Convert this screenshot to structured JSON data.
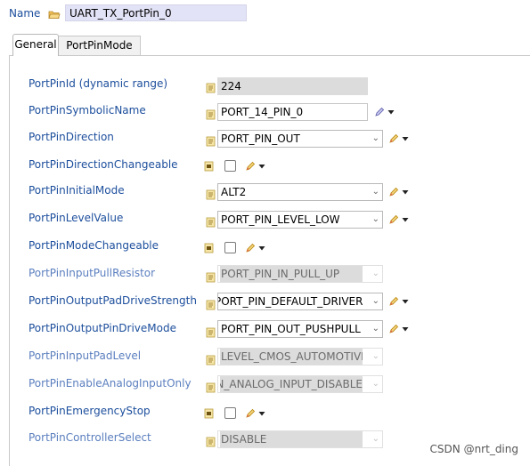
{
  "header": {
    "name_label": "Name",
    "name_value": "UART_TX_PortPin_0"
  },
  "tabs": [
    {
      "label": "General"
    },
    {
      "label": "PortPinMode"
    }
  ],
  "rows": [
    {
      "label": "PortPinId (dynamic range)",
      "value": "224"
    },
    {
      "label": "PortPinSymbolicName",
      "value": "PORT_14_PIN_0"
    },
    {
      "label": "PortPinDirection",
      "value": "PORT_PIN_OUT"
    },
    {
      "label": "PortPinDirectionChangeable"
    },
    {
      "label": "PortPinInitialMode",
      "value": "ALT2"
    },
    {
      "label": "PortPinLevelValue",
      "value": "PORT_PIN_LEVEL_LOW"
    },
    {
      "label": "PortPinModeChangeable"
    },
    {
      "label": "PortPinInputPullResistor",
      "value": "PORT_PIN_IN_PULL_UP"
    },
    {
      "label": "PortPinOutputPadDriveStrength",
      "value": "PORT_PIN_DEFAULT_DRIVER"
    },
    {
      "label": "PortPinOutputPinDriveMode",
      "value": "PORT_PIN_OUT_PUSHPULL"
    },
    {
      "label": "PortPinInputPadLevel",
      "value": "LEVEL_CMOS_AUTOMOTIVE"
    },
    {
      "label": "PortPinEnableAnalogInputOnly",
      "value": "PORT_PIN_ANALOG_INPUT_DISABLE"
    },
    {
      "label": "PortPinEmergencyStop"
    },
    {
      "label": "PortPinControllerSelect",
      "value": "DISABLE"
    }
  ],
  "watermark": "CSDN @nrt_ding"
}
